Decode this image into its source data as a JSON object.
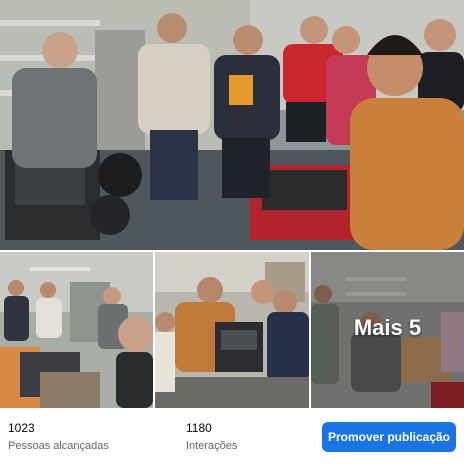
{
  "gallery": {
    "more_label": "Mais 5"
  },
  "stats": [
    {
      "value": "1023",
      "label": "Pessoas alcançadas"
    },
    {
      "value": "1180",
      "label": "Interações"
    }
  ],
  "actions": {
    "promote_label": "Promover publicação"
  },
  "colors": {
    "primary_button": "#1b74e4",
    "secondary_text": "#65676b"
  }
}
